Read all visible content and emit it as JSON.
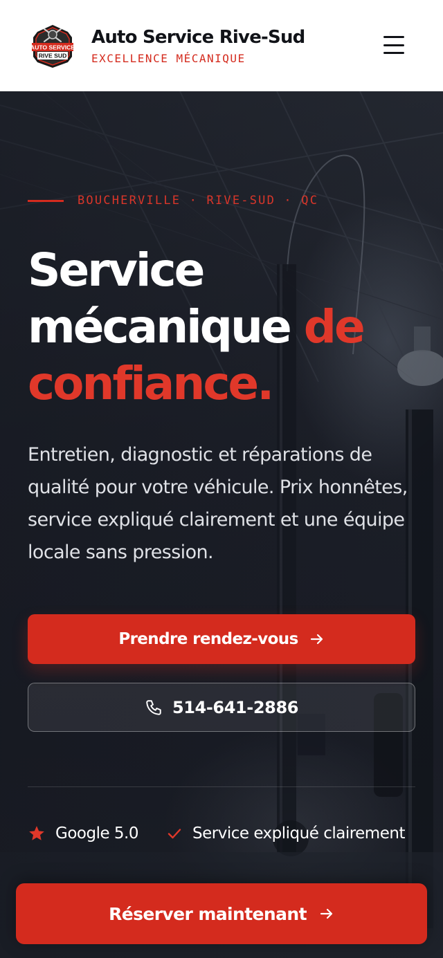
{
  "header": {
    "logo_line1": "AUTO SERVICE",
    "logo_line2": "RIVE SUD",
    "brand_name": "Auto Service Rive-Sud",
    "tagline": "EXCELLENCE MÉCANIQUE",
    "menu_icon": "hamburger-menu-icon"
  },
  "hero": {
    "eyebrow": "BOUCHERVILLE · RIVE-SUD · QC",
    "headline_1": "Service",
    "headline_2": "mécanique",
    "headline_accent_1": "de",
    "headline_accent_2": "confiance.",
    "lead": "Entretien, diagnostic et réparations de qualité pour votre véhicule. Prix honnêtes, service expliqué clairement et une équipe locale sans pression.",
    "primary_cta": "Prendre rendez-vous",
    "primary_cta_icon": "arrow-right-icon",
    "phone": "514-641-2886",
    "phone_icon": "phone-icon",
    "trust": [
      {
        "icon": "star-icon",
        "label": "Google 5.0"
      },
      {
        "icon": "check-icon",
        "label": "Service expliqué clairement"
      }
    ]
  },
  "sticky_cta": {
    "label": "Réserver maintenant",
    "icon": "arrow-right-icon"
  },
  "colors": {
    "brand_red": "#d42b1e",
    "header_bg": "#ffffff",
    "hero_bg": "#1b1f29",
    "text_light": "#dfe1e6"
  }
}
